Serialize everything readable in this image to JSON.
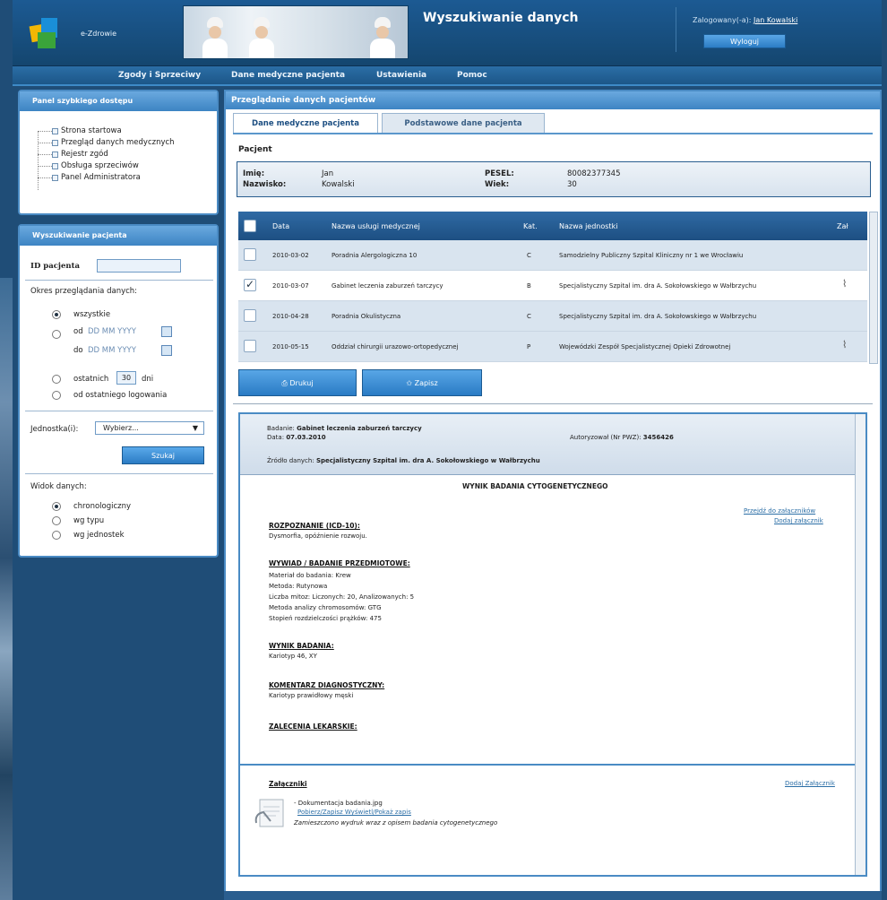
{
  "header": {
    "brand": "e-Zdrowie",
    "title": "Wyszukiwanie danych",
    "logged_label": "Zalogowany(-a):",
    "user_name": "Jan Kowalski",
    "logout": "Wyloguj"
  },
  "nav": [
    "Zgody i Sprzeciwy",
    "Dane medyczne pacjenta",
    "Ustawienia",
    "Pomoc"
  ],
  "quick_panel": {
    "title": "Panel szybkiego dostępu",
    "items": [
      "Strona startowa",
      "Przegląd danych medycznych",
      "Rejestr zgód",
      "Obsługa sprzeciwów",
      "Panel Administratora"
    ]
  },
  "search_panel": {
    "title": "Wyszukiwanie pacjenta",
    "id_label": "ID pacjenta",
    "period_label": "Okres przeglądania danych:",
    "opt_all": "wszystkie",
    "from_label": "od",
    "to_label": "do",
    "date_placeholder": "DD MM YYYY",
    "last_label": "ostatnich",
    "last_days": "30",
    "days_label": "dni",
    "since_login": "od ostatniego logowania",
    "unit_label": "Jednostka(i):",
    "unit_select": "Wybierz...",
    "search_btn": "Szukaj",
    "view_label": "Widok danych:",
    "view_opts": [
      "chronologiczny",
      "wg typu",
      "wg jednostek"
    ]
  },
  "main": {
    "title": "Przeglądanie danych pacjentów",
    "tabs": [
      "Dane medyczne pacjenta",
      "Podstawowe dane pacjenta"
    ],
    "patient_label": "Pacjent",
    "patient": {
      "first_label": "Imię:",
      "last_label": "Nazwisko:",
      "first": "Jan",
      "last": "Kowalski",
      "pesel_label": "PESEL:",
      "age_label": "Wiek:",
      "pesel": "80082377345",
      "age": "30"
    },
    "table": {
      "headers": [
        "Data",
        "Nazwa usługi medycznej",
        "Kat.",
        "Nazwa jednostki",
        "Zał"
      ],
      "rows": [
        {
          "date": "2010-03-02",
          "service": "Poradnia Alergologiczna 10",
          "cat": "C",
          "unit": "Samodzielny Publiczny Szpital Kliniczny nr 1 we Wrocławiu",
          "checked": false,
          "attach": false
        },
        {
          "date": "2010-03-07",
          "service": "Gabinet leczenia zaburzeń tarczycy",
          "cat": "B",
          "unit": "Specjalistyczny Szpital im. dra A. Sokołowskiego w Wałbrzychu",
          "checked": true,
          "attach": true
        },
        {
          "date": "2010-04-28",
          "service": "Poradnia Okulistyczna",
          "cat": "C",
          "unit": "Specjalistyczny Szpital im. dra A. Sokołowskiego w Wałbrzychu",
          "checked": false,
          "attach": false
        },
        {
          "date": "2010-05-15",
          "service": "Oddział chirurgii urazowo-ortopedycznej",
          "cat": "P",
          "unit": "Wojewódzki Zespół Specjalistycznej Opieki Zdrowotnej",
          "checked": false,
          "attach": true
        }
      ]
    },
    "btn_print": "Drukuj",
    "btn_save": "Zapisz",
    "detail": {
      "study_label": "Badanie:",
      "study": "Gabinet leczenia zaburzeń tarczycy",
      "date_label": "Data:",
      "date": "07.03.2010",
      "ac_label": "Autoryzował (Nr PWZ):",
      "ac": "3456426",
      "source_label": "Źródło danych:",
      "source": "Specjalistyczny Szpital im. dra A. Sokołowskiego w Wałbrzychu",
      "result_title": "WYNIK BADANIA CYTOGENETYCZNEGO",
      "link1": "Przejdź do załączników",
      "link2": "Dodaj załącznik",
      "s1": "ROZPOZNANIE (ICD-10):",
      "s1_text": "Dysmorfia, opóźnienie rozwoju.",
      "s2": "WYWIAD / BADANIE PRZEDMIOTOWE:",
      "s2_lines": [
        "Materiał do badania: Krew",
        "Metoda: Rutynowa",
        "Liczba mitoz: Liczonych: 20, Analizowanych: 5",
        "Metoda analizy chromosomów: GTG",
        "Stopień rozdzielczości prążków: 475"
      ],
      "s3": "WYNIK BADANIA:",
      "s3_text": "Kariotyp 46, XY",
      "s4": "KOMENTARZ DIAGNOSTYCZNY:",
      "s4_text": "Kariotyp prawidłowy męski",
      "s5": "ZALECENIA LEKARSKIE:",
      "att_title": "Załączniki",
      "att_add": "Dodaj Załącznik",
      "att_file": "- Dokumentacja badania.jpg",
      "att_links": "Pobierz/Zapisz   Wyświetl/Pokaż zapis",
      "att_desc": "Zamieszczono wydruk wraz z opisem badania cytogenetycznego"
    }
  }
}
